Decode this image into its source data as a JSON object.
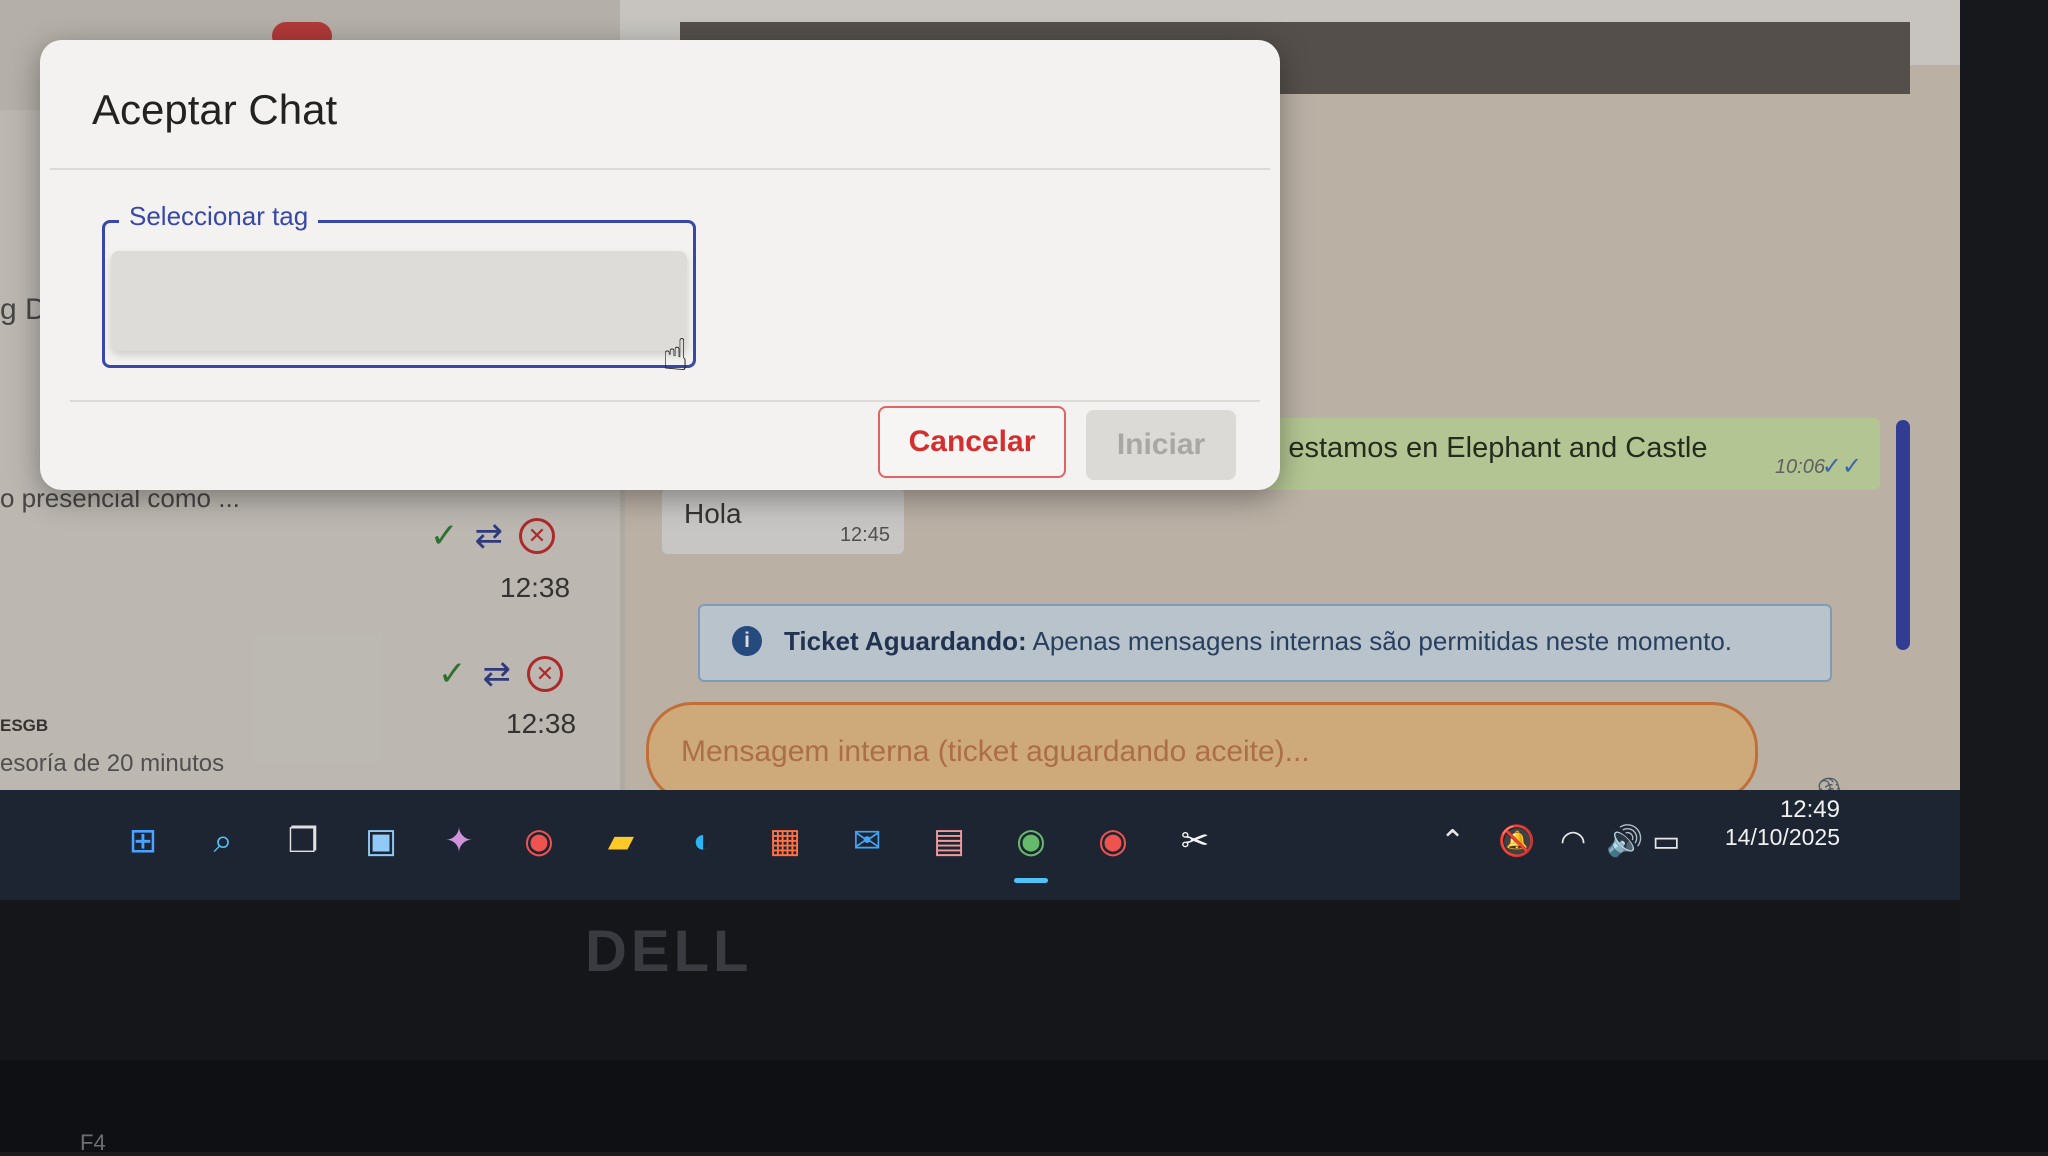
{
  "dialog": {
    "title": "Aceptar Chat",
    "tag_select_label": "Seleccionar tag",
    "cancel_label": "Cancelar",
    "start_label": "Iniciar"
  },
  "left_panel": {
    "contact_snippet": "g Dig",
    "rows": [
      {
        "preview": "o presencial como ...",
        "time": "12:38"
      },
      {
        "tag": "ESGB",
        "preview": "esoría de 20 minutos",
        "time": "12:38"
      }
    ]
  },
  "chat": {
    "outgoing_message": {
      "text": "do estamos en Elephant and Castle",
      "time": "10:06"
    },
    "incoming_message": {
      "text": "Hola",
      "time": "12:45"
    },
    "info_banner": {
      "title": "Ticket Aguardando:",
      "text": "Apenas mensagens internas são permitidas neste momento."
    },
    "internal_input_placeholder": "Mensagem interna (ticket aguardando aceite)..."
  },
  "taskbar": {
    "apps": [
      "windows-start",
      "search",
      "task-view",
      "widgets",
      "copilot",
      "chrome",
      "file-explorer",
      "edge",
      "microsoft-store",
      "mail",
      "photos",
      "chrome-active",
      "chrome-profile",
      "capcut"
    ],
    "clock_time": "12:49",
    "clock_date": "14/10/2025"
  },
  "device": {
    "brand": "DELL",
    "key_label": "F4"
  },
  "colors": {
    "accent": "#3848a8",
    "cancel_red": "#d32f2f",
    "internal_orange": "#e07a3a",
    "info_blue": "#1f4f8f"
  }
}
